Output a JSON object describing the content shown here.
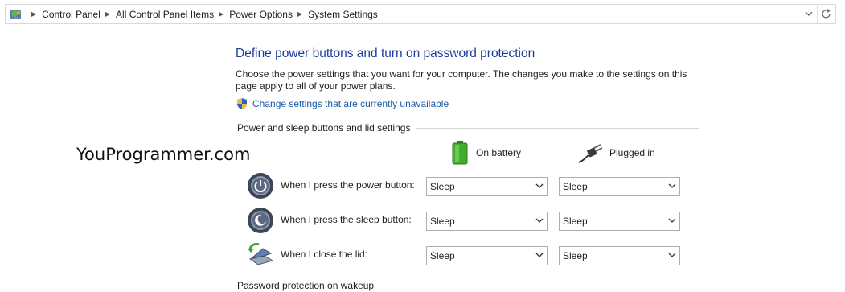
{
  "address_bar": {
    "crumbs": [
      "Control Panel",
      "All Control Panel Items",
      "Power Options",
      "System Settings"
    ],
    "icon": "control-panel-icon",
    "dropdown_icon": "chevron-down-icon",
    "refresh_icon": "refresh-icon"
  },
  "page": {
    "title": "Define power buttons and turn on password protection",
    "description": "Choose the power settings that you want for your computer. The changes you make to the settings on this page apply to all of your power plans.",
    "change_link": "Change settings that are currently unavailable"
  },
  "watermark": "YouProgrammer.com",
  "power_section": {
    "header": "Power and sleep buttons and lid settings",
    "col_battery": "On battery",
    "col_plugged": "Plugged in",
    "rows": [
      {
        "label": "When I press the power button:",
        "battery": "Sleep",
        "plugged": "Sleep",
        "icon": "power-button-icon"
      },
      {
        "label": "When I press the sleep button:",
        "battery": "Sleep",
        "plugged": "Sleep",
        "icon": "sleep-button-icon"
      },
      {
        "label": "When I close the lid:",
        "battery": "Sleep",
        "plugged": "Sleep",
        "icon": "laptop-lid-icon"
      }
    ]
  },
  "password_section": {
    "header": "Password protection on wakeup"
  },
  "colors": {
    "title": "#1b3c9c",
    "link": "#1a5aa6",
    "battery_green": "#3fae2a"
  }
}
